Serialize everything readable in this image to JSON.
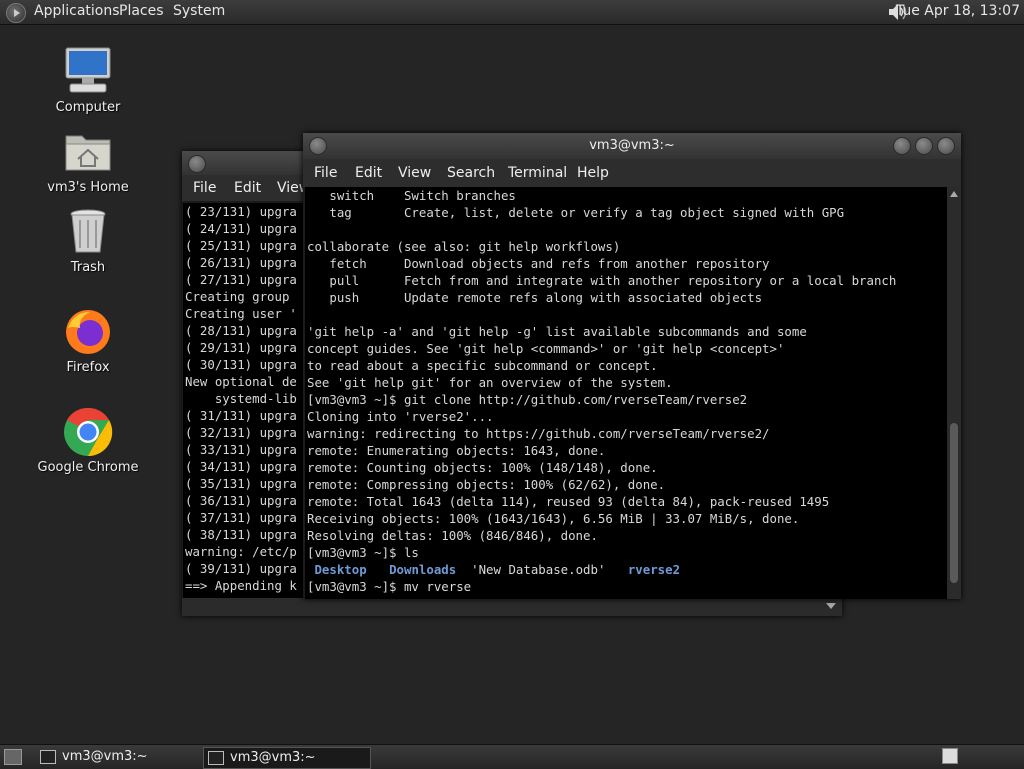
{
  "top_panel": {
    "menus": [
      "Applications",
      "Places",
      "System"
    ],
    "clock": "Tue Apr 18, 13:07"
  },
  "desktop_icons": [
    {
      "label": "Computer",
      "icon": "computer-icon"
    },
    {
      "label": "vm3's Home",
      "icon": "home-folder-icon"
    },
    {
      "label": "Trash",
      "icon": "trash-icon"
    },
    {
      "label": "Firefox",
      "icon": "firefox-icon"
    },
    {
      "label": "Google Chrome",
      "icon": "chrome-icon"
    }
  ],
  "back_terminal": {
    "menus": [
      "File",
      "Edit",
      "View"
    ],
    "lines": [
      "( 23/131) upgra",
      "( 24/131) upgra",
      "( 25/131) upgra",
      "( 26/131) upgra",
      "( 27/131) upgra",
      "Creating group ",
      "Creating user '",
      "( 28/131) upgra",
      "( 29/131) upgra",
      "( 30/131) upgra",
      "New optional de",
      "    systemd-lib",
      "( 31/131) upgra",
      "( 32/131) upgra",
      "( 33/131) upgra",
      "( 34/131) upgra",
      "( 35/131) upgra",
      "( 36/131) upgra",
      "( 37/131) upgra",
      "( 38/131) upgra",
      "warning: /etc/p",
      "( 39/131) upgra",
      "==> Appending k"
    ]
  },
  "front_terminal": {
    "title": "vm3@vm3:~",
    "menus": [
      "File",
      "Edit",
      "View",
      "Search",
      "Terminal",
      "Help"
    ],
    "lines": [
      "   switch    Switch branches",
      "   tag       Create, list, delete or verify a tag object signed with GPG",
      "",
      "collaborate (see also: git help workflows)",
      "   fetch     Download objects and refs from another repository",
      "   pull      Fetch from and integrate with another repository or a local branch",
      "   push      Update remote refs along with associated objects",
      "",
      "'git help -a' and 'git help -g' list available subcommands and some",
      "concept guides. See 'git help <command>' or 'git help <concept>'",
      "to read about a specific subcommand or concept.",
      "See 'git help git' for an overview of the system.",
      "[vm3@vm3 ~]$ git clone http://github.com/rverseTeam/rverse2",
      "Cloning into 'rverse2'...",
      "warning: redirecting to https://github.com/rverseTeam/rverse2/",
      "remote: Enumerating objects: 1643, done.",
      "remote: Counting objects: 100% (148/148), done.",
      "remote: Compressing objects: 100% (62/62), done.",
      "remote: Total 1643 (delta 114), reused 93 (delta 84), pack-reused 1495",
      "Receiving objects: 100% (1643/1643), 6.56 MiB | 33.07 MiB/s, done.",
      "Resolving deltas: 100% (846/846), done.",
      "[vm3@vm3 ~]$ ls"
    ],
    "ls_output": {
      "dir1": "Desktop",
      "dir2": "Downloads",
      "file1": "'New Database.odb'",
      "dir3": "rverse2"
    },
    "current_prompt": "[vm3@vm3 ~]$ mv rverse"
  },
  "taskbar": {
    "tasks": [
      "vm3@vm3:~",
      "vm3@vm3:~"
    ]
  },
  "colors": {
    "directory": "#6e9ad6",
    "terminal_bg": "#000000",
    "desktop_bg": "#252525"
  }
}
